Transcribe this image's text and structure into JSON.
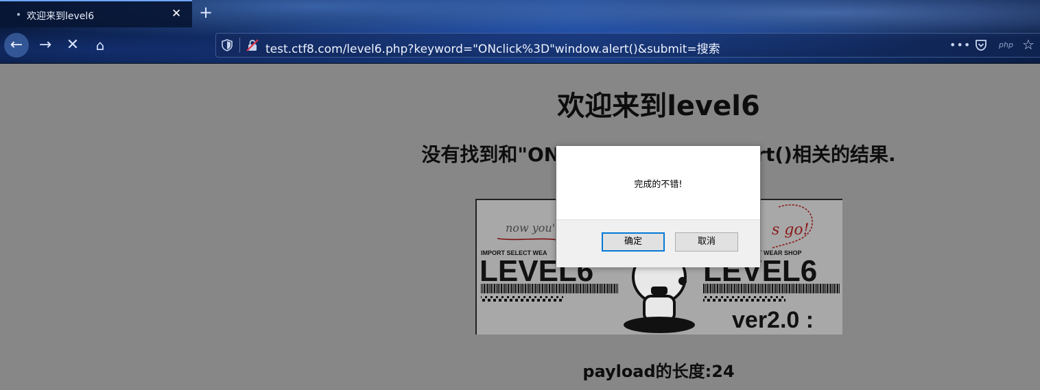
{
  "tab": {
    "title": "欢迎来到level6",
    "close": "✕"
  },
  "toolbar": {
    "new_tab": "+",
    "back": "←",
    "forward": "→",
    "stop": "✕",
    "home": "⌂"
  },
  "urlbar": {
    "url": "test.ctf8.com/level6.php?keyword=\"ONclick%3D\"window.alert()&submit=搜索",
    "menu_dots": "•••",
    "php_label": "php",
    "star": "☆"
  },
  "page": {
    "heading": "欢迎来到level6",
    "result": "没有找到和\"ONclick=\"window.alert()相关的结果.",
    "payload_length": "payload的长度:24",
    "logo": {
      "handwriting_left": "now you're",
      "handwriting_right": "s go!",
      "shop_left": "IMPORT SELECT WEA",
      "shop_right": "T WEAR SHOP",
      "level_left": "LEVEL6",
      "level_right": "LEVEL6",
      "version": "ver2.0 :"
    }
  },
  "dialog": {
    "message": "完成的不错!",
    "ok": "确定",
    "cancel": "取消"
  },
  "colors": {
    "accent": "#0078d7",
    "page_bg": "#878787",
    "tab_indicator": "#6ea6ff"
  }
}
